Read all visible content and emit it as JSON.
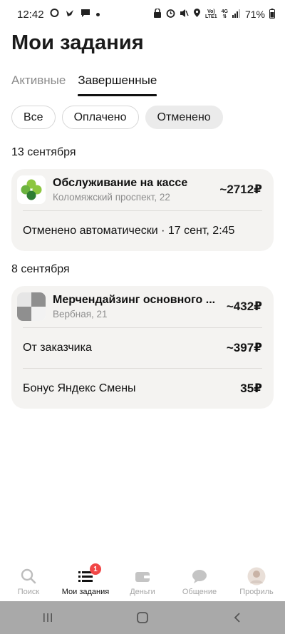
{
  "status_bar": {
    "time": "12:42",
    "battery": "71%",
    "network_top": "Vo)",
    "network_bottom": "LTE1",
    "signal_label": "4G"
  },
  "title": "Мои задания",
  "tabs": [
    {
      "label": "Активные",
      "active": false
    },
    {
      "label": "Завершенные",
      "active": true
    }
  ],
  "filters": [
    {
      "label": "Все",
      "selected": false
    },
    {
      "label": "Оплачено",
      "selected": false
    },
    {
      "label": "Отменено",
      "selected": true
    }
  ],
  "groups": [
    {
      "date": "13 сентября",
      "task": {
        "title": "Обслуживание на кассе",
        "address": "Коломяжский проспект, 22",
        "amount": "~2712₽",
        "logo": "green-clover-logo",
        "rows": [
          {
            "label": "Отменено автоматически · 17 сент, 2:45",
            "value": ""
          }
        ]
      }
    },
    {
      "date": "8 сентября",
      "task": {
        "title": "Мерчендайзинг основного ...",
        "address": "Вербная, 21",
        "amount": "~432₽",
        "logo": "checker-placeholder-logo",
        "rows": [
          {
            "label": "От заказчика",
            "value": "~397₽"
          },
          {
            "label": "Бонус Яндекс Смены",
            "value": "35₽"
          }
        ]
      }
    }
  ],
  "bottom_nav": [
    {
      "label": "Поиск",
      "icon": "search-icon",
      "active": false
    },
    {
      "label": "Мои задания",
      "icon": "list-icon",
      "active": true,
      "badge": "1"
    },
    {
      "label": "Деньги",
      "icon": "wallet-icon",
      "active": false
    },
    {
      "label": "Общение",
      "icon": "chat-icon",
      "active": false
    },
    {
      "label": "Профиль",
      "icon": "avatar-icon",
      "active": false
    }
  ],
  "colors": {
    "accent": "#111111",
    "card_bg": "#f4f3f1",
    "badge": "#f14646",
    "logo_green": "#7bbf3a",
    "logo_dark_green": "#2e7d32"
  }
}
